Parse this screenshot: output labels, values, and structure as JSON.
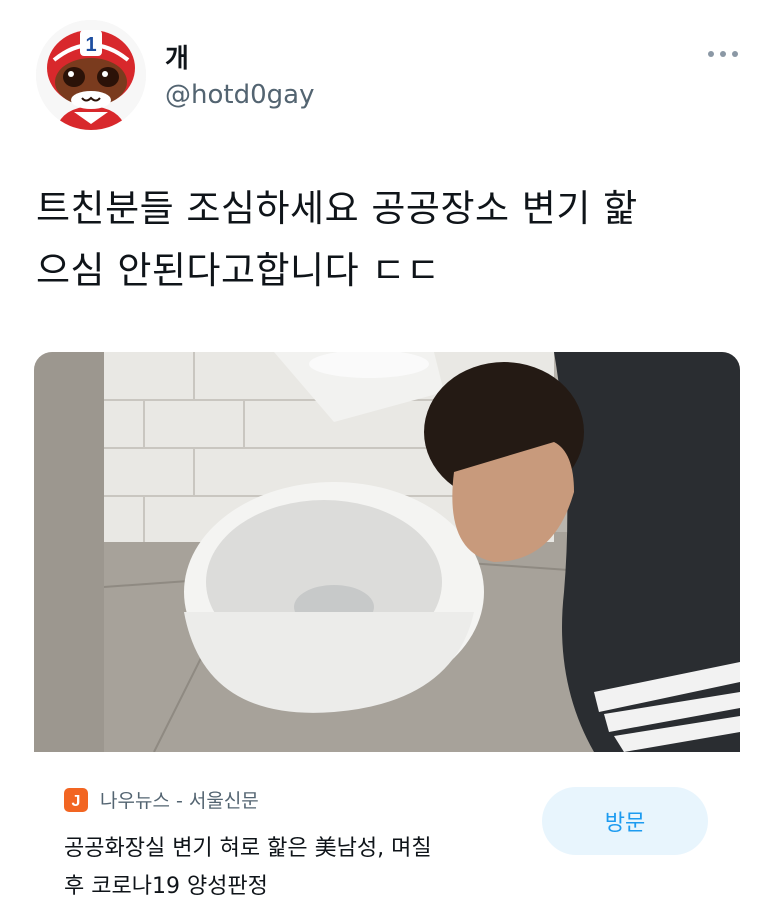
{
  "user": {
    "display_name": "개",
    "handle": "@hotd0gay",
    "avatar_number": "1"
  },
  "tweet": {
    "line1": "트친분들 조심하세요 공공장소 변기 핥",
    "line2": "으심 안된다고합니다 ㄷㄷ"
  },
  "card": {
    "source": "나우뉴스 - 서울신문",
    "source_logo_glyph": "J",
    "headline_line1": "공공화장실 변기 혀로 핥은 美남성, 며칠",
    "headline_line2": "후 코로나19 양성판정",
    "visit_label": "방문"
  },
  "colors": {
    "link_blue": "#1d9bf0",
    "visit_bg": "#e8f5fd",
    "muted": "#536471",
    "logo_orange": "#f26522"
  }
}
